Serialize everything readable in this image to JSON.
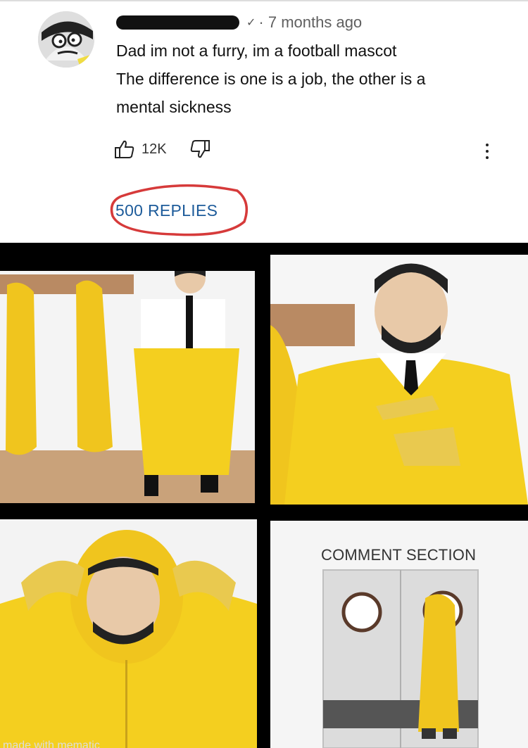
{
  "comment": {
    "timestamp": "7 months ago",
    "lines": [
      "Dad im not a furry, im a football mascot",
      "The difference is one is a job, the other is a",
      "mental sickness"
    ],
    "likes": "12K",
    "replies": "500 REPLIES",
    "icons": {
      "avatar": "cartoon-face-avatar",
      "verified": "check-icon",
      "like": "thumbs-up-icon",
      "dislike": "thumbs-down-icon",
      "more": "more-vertical-icon"
    },
    "colors": {
      "replies_link": "#1d5b9a",
      "highlight_circle": "#d63a3a"
    }
  },
  "meme": {
    "caption": "COMMENT SECTION",
    "watermark": "made with mematic",
    "colors": {
      "hazmat_yellow": "#f4cf1f",
      "floor": "#c9a27a"
    }
  }
}
